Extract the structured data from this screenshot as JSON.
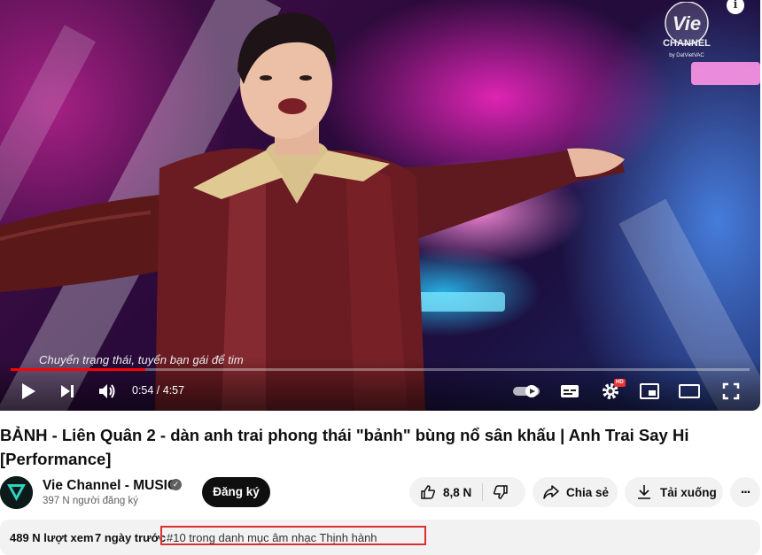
{
  "video": {
    "subtitle": "Chuyển trạng thái, tuyển bạn gái để tim",
    "current_time": "0:54",
    "duration": "4:57",
    "time_display": "0:54 / 4:57",
    "progress": 0.182,
    "quality_badge": "HD",
    "channel_logo_text": "Vie",
    "channel_logo_sub": "CHANNEL",
    "channel_logo_by": "by DatVietVAC",
    "info_label": "i"
  },
  "title": "BẢNH - Liên Quân 2 - dàn anh trai phong thái \"bảnh\" bùng nổ sân khấu | Anh Trai Say Hi [Performance]",
  "channel": {
    "name": "Vie Channel - MUSIC",
    "subscribers": "397 N người đăng ký",
    "subscribe_label": "Đăng ký"
  },
  "actions": {
    "likes": "8,8 N",
    "share_label": "Chia sẻ",
    "download_label": "Tải xuống",
    "more_label": "..."
  },
  "description": {
    "views": "489 N lượt xem",
    "posted": "7 ngày trước",
    "trending": "#10 trong danh mục âm nhạc Thịnh hành"
  },
  "colors": {
    "accent": "#ff0000",
    "highlight_box": "#d93030",
    "button_dark": "#0f0f0f",
    "pill_bg": "#f2f2f2"
  },
  "icons": [
    "play-icon",
    "next-icon",
    "volume-icon",
    "autoplay-toggle-icon",
    "captions-icon",
    "settings-icon",
    "miniplayer-icon",
    "theater-icon",
    "fullscreen-icon",
    "like-icon",
    "dislike-icon",
    "share-icon",
    "download-icon",
    "more-icon",
    "verified-icon",
    "info-icon"
  ]
}
